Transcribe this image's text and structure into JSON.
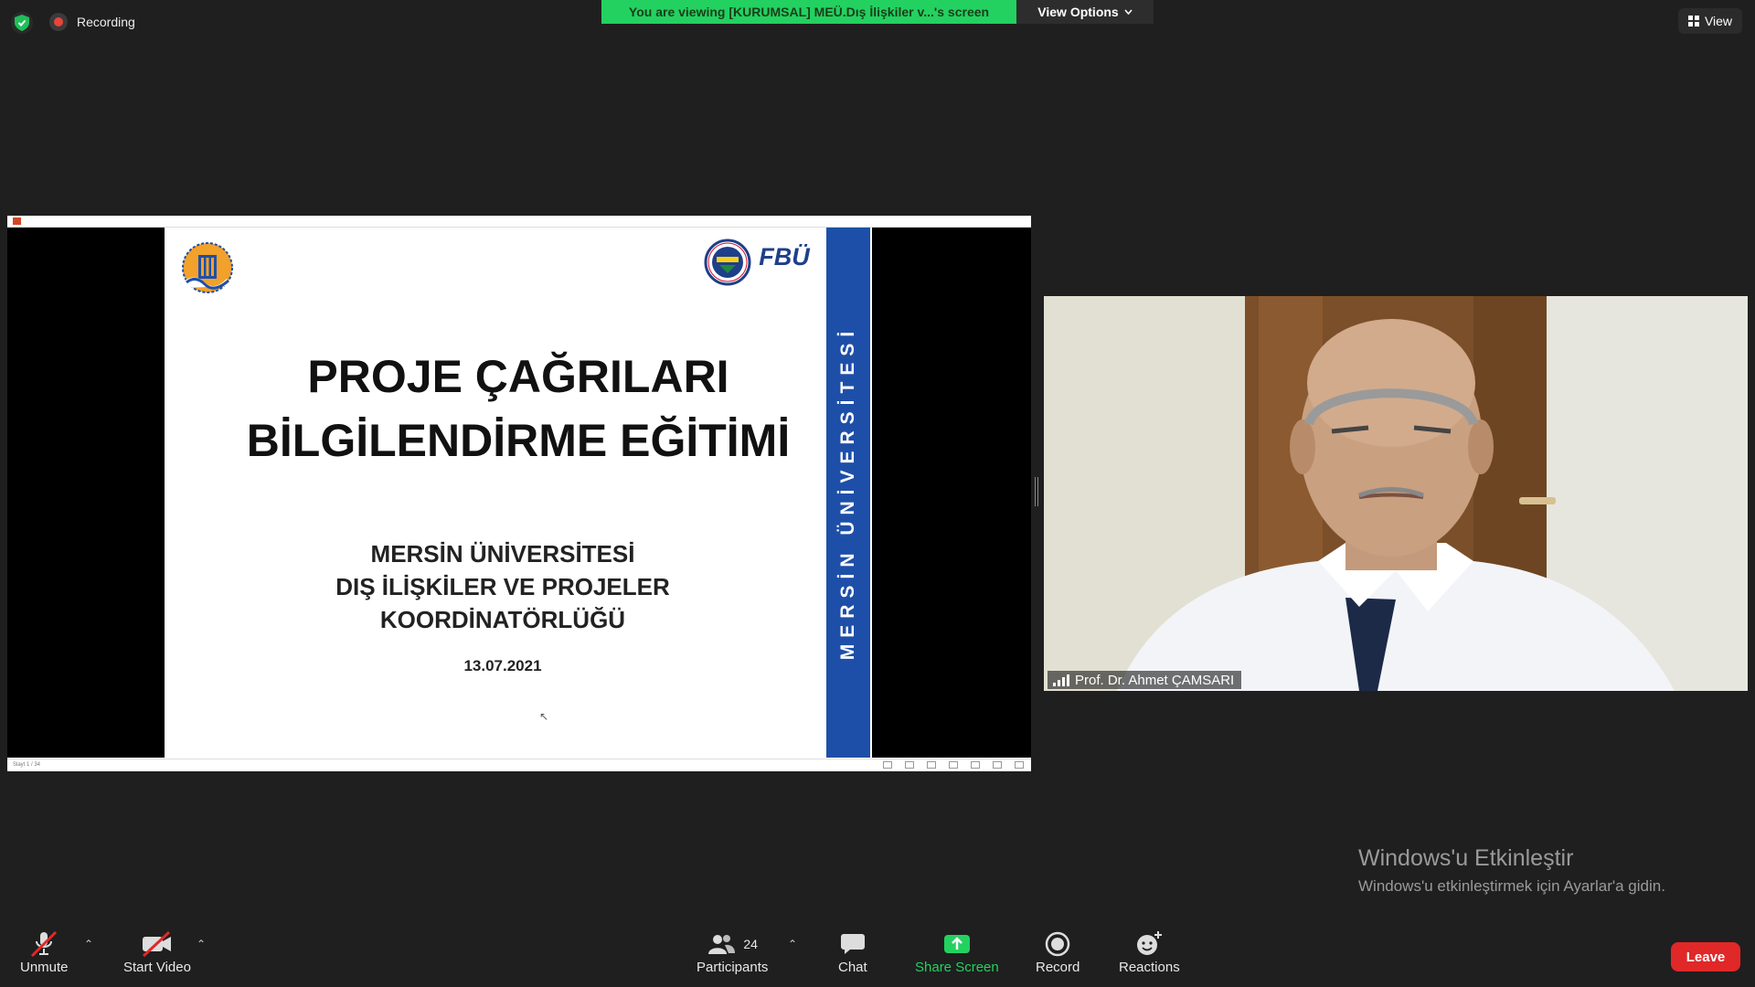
{
  "top": {
    "recording_label": "Recording",
    "viewing_banner": "You are viewing [KURUMSAL] MEÜ.Dış İlişkiler v...'s screen",
    "view_options_label": "View Options",
    "view_label": "View"
  },
  "slide": {
    "title_line1": "PROJE ÇAĞRILARI",
    "title_line2": "BİLGİLENDİRME EĞİTİMİ",
    "sub_line1": "MERSİN ÜNİVERSİTESİ",
    "sub_line2": "DIŞ İLİŞKİLER VE PROJELER",
    "sub_line3": "KOORDİNATÖRLÜĞÜ",
    "date": "13.07.2021",
    "vertical_text": "MERSİN ÜNİVERSİTESİ",
    "fbu_logo_text": "FBÜ",
    "status_left": "Slayt 1 / 34"
  },
  "participant": {
    "name": "Prof. Dr. Ahmet ÇAMSARI"
  },
  "watermark": {
    "title": "Windows'u Etkinleştir",
    "subtitle": "Windows'u etkinleştirmek için Ayarlar'a gidin."
  },
  "toolbar": {
    "unmute": "Unmute",
    "start_video": "Start Video",
    "participants": "Participants",
    "participant_count": "24",
    "chat": "Chat",
    "share_screen": "Share Screen",
    "record": "Record",
    "reactions": "Reactions",
    "leave": "Leave"
  },
  "colors": {
    "banner_green": "#23d160",
    "slide_blue": "#1e4fa8",
    "leave_red": "#e02828"
  }
}
